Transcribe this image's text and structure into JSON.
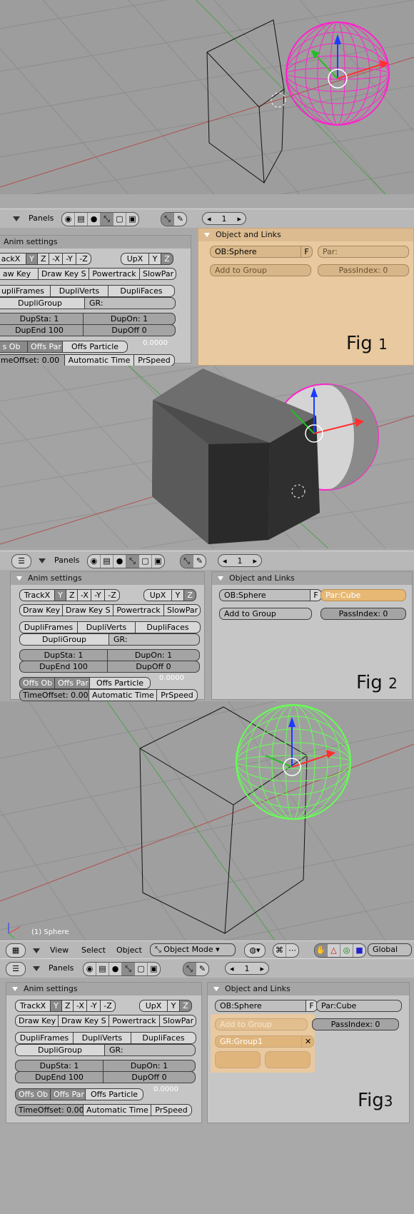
{
  "header": {
    "panels_label": "Panels",
    "frame_number": "1"
  },
  "anim_settings": {
    "title": "Anim settings",
    "track_row": [
      "TrackX",
      "Y",
      "Z",
      "-X",
      "-Y",
      "-Z"
    ],
    "up_row": [
      "UpX",
      "Y",
      "Z"
    ],
    "key_row": [
      "Draw Key",
      "Draw Key S",
      "Powertrack",
      "SlowPar"
    ],
    "dupli_row": [
      "DupliFrames",
      "DupliVerts",
      "DupliFaces"
    ],
    "dupli_group": "DupliGroup",
    "gr_label": "GR:",
    "dup_sta": "DupSta: 1",
    "dup_on": "DupOn: 1",
    "dup_end": "DupEnd 100",
    "dup_off": "DupOff 0",
    "offs_row": [
      "Offs Ob",
      "Offs Par",
      "Offs Particle"
    ],
    "offs_value": "0.0000",
    "time_offset": "TimeOffset: 0.00",
    "automatic_time": "Automatic Time",
    "pr_speed": "PrSpeed"
  },
  "fig1": {
    "track_first": "ackX",
    "key_first": "aw Key",
    "dupli_first": "upliFrames",
    "dupsta": "DupSta: 1",
    "dupend": "DupEnd 100",
    "offs_first": "s Ob",
    "time_first": "meOffset: 0.00",
    "ob": "OB:Sphere",
    "f": "F",
    "par": "Par:",
    "add_group": "Add to Group",
    "pass": "PassIndex: 0",
    "label_word": "Fig",
    "label_num": "1"
  },
  "fig2": {
    "ob": "OB:Sphere",
    "f": "F",
    "par": "Par:Cube",
    "add_group": "Add to Group",
    "pass": "PassIndex: 0",
    "label_word": "Fig",
    "label_num": "2"
  },
  "fig3": {
    "axis_label": "(1) Sphere",
    "menu": [
      "View",
      "Select",
      "Object"
    ],
    "mode": "Object Mode",
    "orientation": "Global",
    "ob": "OB:Sphere",
    "f": "F",
    "par": "Par:Cube",
    "add_group": "Add to Group",
    "pass": "PassIndex: 0",
    "group": "GR:Group1",
    "label_word": "Fig",
    "label_num": "3"
  },
  "object_links_title": "Object and Links",
  "colors": {
    "sphere_fig1": "#ff22cc",
    "sphere_fig3": "#66ff55",
    "highlight": "#e8c9a0"
  }
}
